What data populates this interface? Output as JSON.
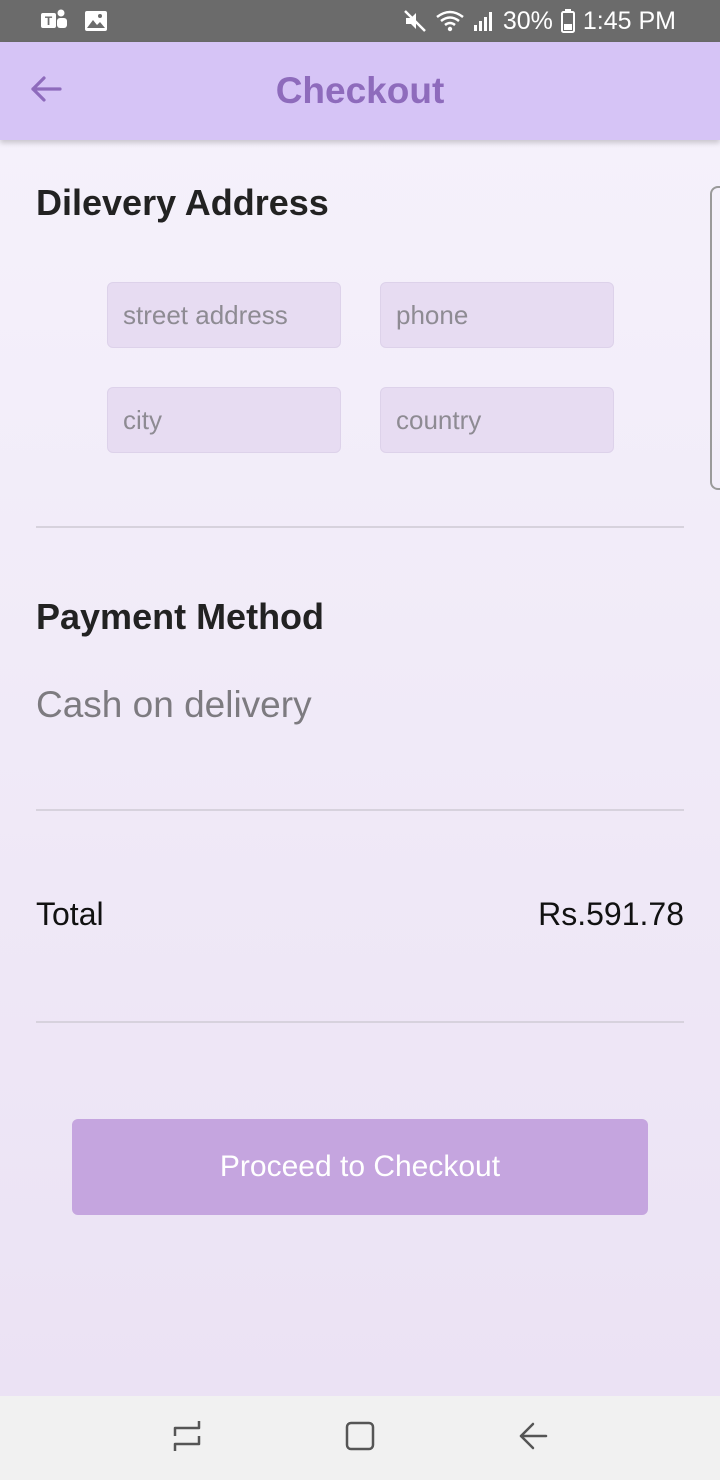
{
  "status_bar": {
    "battery_percent": "30%",
    "time": "1:45 PM",
    "left_icons": [
      "teams-icon",
      "gallery-icon"
    ],
    "right_icons": [
      "mute-icon",
      "wifi-icon",
      "signal-icon",
      "battery-icon"
    ]
  },
  "app_bar": {
    "title": "Checkout",
    "back_icon": "arrow-left-icon"
  },
  "delivery": {
    "title": "Dilevery Address",
    "street_placeholder": "street address",
    "phone_placeholder": "phone",
    "city_placeholder": "city",
    "country_placeholder": "country"
  },
  "payment": {
    "title": "Payment Method",
    "value": "Cash on delivery"
  },
  "total": {
    "label": "Total",
    "value": "Rs.591.78"
  },
  "checkout_button": {
    "label": "Proceed to Checkout"
  },
  "nav_bar": {
    "icons": [
      "recent-apps-icon",
      "home-icon",
      "back-icon"
    ]
  },
  "colors": {
    "app_bar_bg": "#d6c4f6",
    "title_color": "#8e6bbc",
    "button_bg": "#c5a5df",
    "input_bg": "#e7dcf2"
  }
}
